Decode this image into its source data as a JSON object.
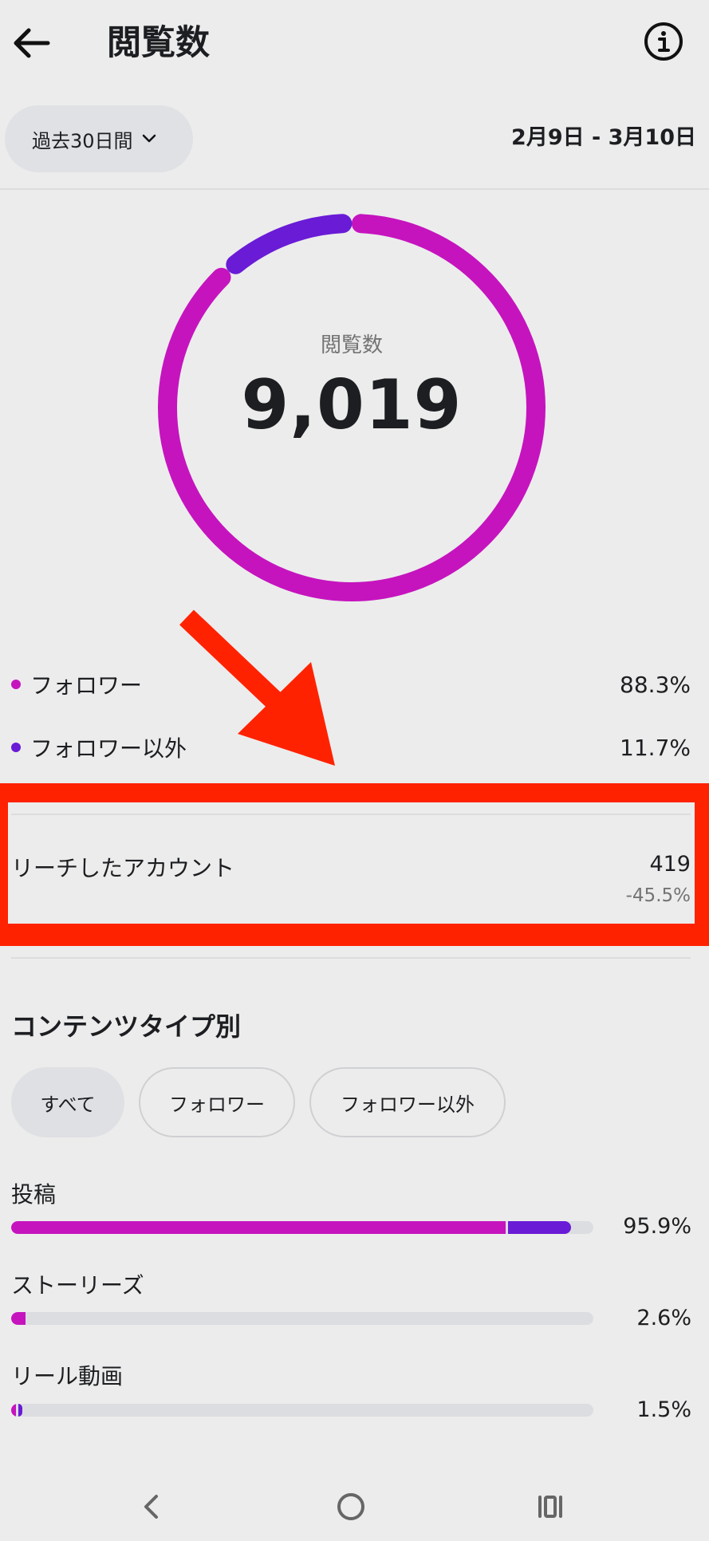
{
  "header": {
    "title": "閲覧数",
    "back_icon": "arrow-left-icon",
    "info_icon": "info-icon"
  },
  "date_filter": {
    "selected": "過去30日間",
    "range": "2月9日 - 3月10日"
  },
  "donut": {
    "label": "閲覧数",
    "value": "9,019",
    "segments": [
      {
        "name": "フォロワー",
        "fraction": 0.883,
        "color": "#c514be"
      },
      {
        "name": "フォロワー以外",
        "fraction": 0.117,
        "color": "#6a1bd6"
      }
    ]
  },
  "legend": [
    {
      "label": "フォロワー",
      "pct": "88.3%",
      "color": "#c514be"
    },
    {
      "label": "フォロワー以外",
      "pct": "11.7%",
      "color": "#6a1bd6"
    }
  ],
  "reach": {
    "label": "リーチしたアカウント",
    "value": "419",
    "change": "-45.5%"
  },
  "content_type": {
    "title": "コンテンツタイプ別",
    "chips": [
      "すべて",
      "フォロワー",
      "フォロワー以外"
    ],
    "rows": [
      {
        "label": "投稿",
        "pct": "95.9%",
        "followers_fraction": 0.849,
        "nonfollowers_fraction": 0.108
      },
      {
        "label": "ストーリーズ",
        "pct": "2.6%",
        "followers_fraction": 0.024,
        "nonfollowers_fraction": 0.0
      },
      {
        "label": "リール動画",
        "pct": "1.5%",
        "followers_fraction": 0.008,
        "nonfollowers_fraction": 0.007
      }
    ]
  },
  "colors": {
    "followers": "#c514be",
    "nonfollowers": "#6a1bd6",
    "highlight": "#ff2200"
  },
  "system_nav": {
    "back_icon": "chevron-left-icon",
    "home_icon": "home-circle-icon",
    "recents_icon": "recents-icon"
  }
}
